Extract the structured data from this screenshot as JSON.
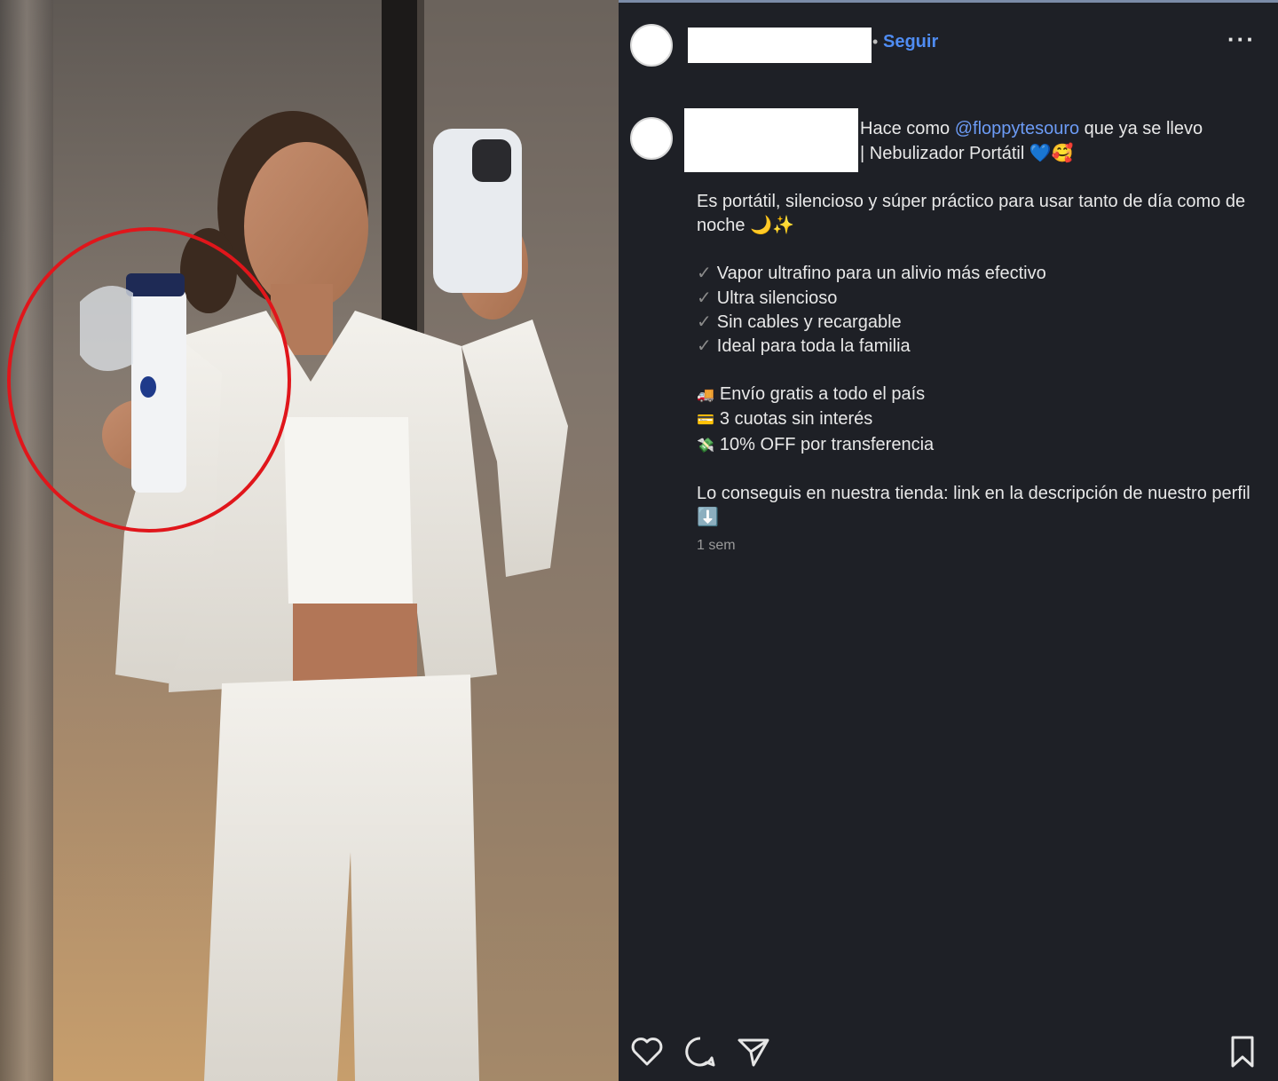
{
  "post": {
    "follow_label": "Seguir",
    "more_label": "···",
    "caption_head_prefix": "Hace como ",
    "mention": "@floppytesouro",
    "caption_head_suffix": " que ya se llevo",
    "caption_head_line2": "| Nebulizador Portátil 💙🥰",
    "intro": "Es portátil, silencioso y súper práctico para usar tanto de día como de noche 🌙✨",
    "check_symbol": "✓",
    "features": [
      "Vapor ultrafino para un alivio más efectivo",
      "Ultra silencioso",
      "Sin cables y recargable",
      "Ideal para toda la familia"
    ],
    "perks": [
      {
        "icon": "🚚",
        "icon_name": "truck-icon",
        "text": "Envío gratis a todo el país"
      },
      {
        "icon": "💳",
        "icon_name": "credit-card-icon",
        "text": "3 cuotas sin interés"
      },
      {
        "icon": "💸",
        "icon_name": "money-icon",
        "text": "10% OFF por transferencia"
      }
    ],
    "outro": "Lo conseguis en nuestra tienda: link en la descripción de nuestro perfil ⬇️",
    "time_ago": "1 sem"
  },
  "icons": {
    "like": "heart-icon",
    "comment": "comment-icon",
    "share": "send-icon",
    "save": "bookmark-icon"
  },
  "colors": {
    "panel_bg": "#1e2026",
    "accent_blue": "#4f8cf2",
    "mention_blue": "#6c9bf5",
    "highlight_circle": "#e0161b"
  }
}
